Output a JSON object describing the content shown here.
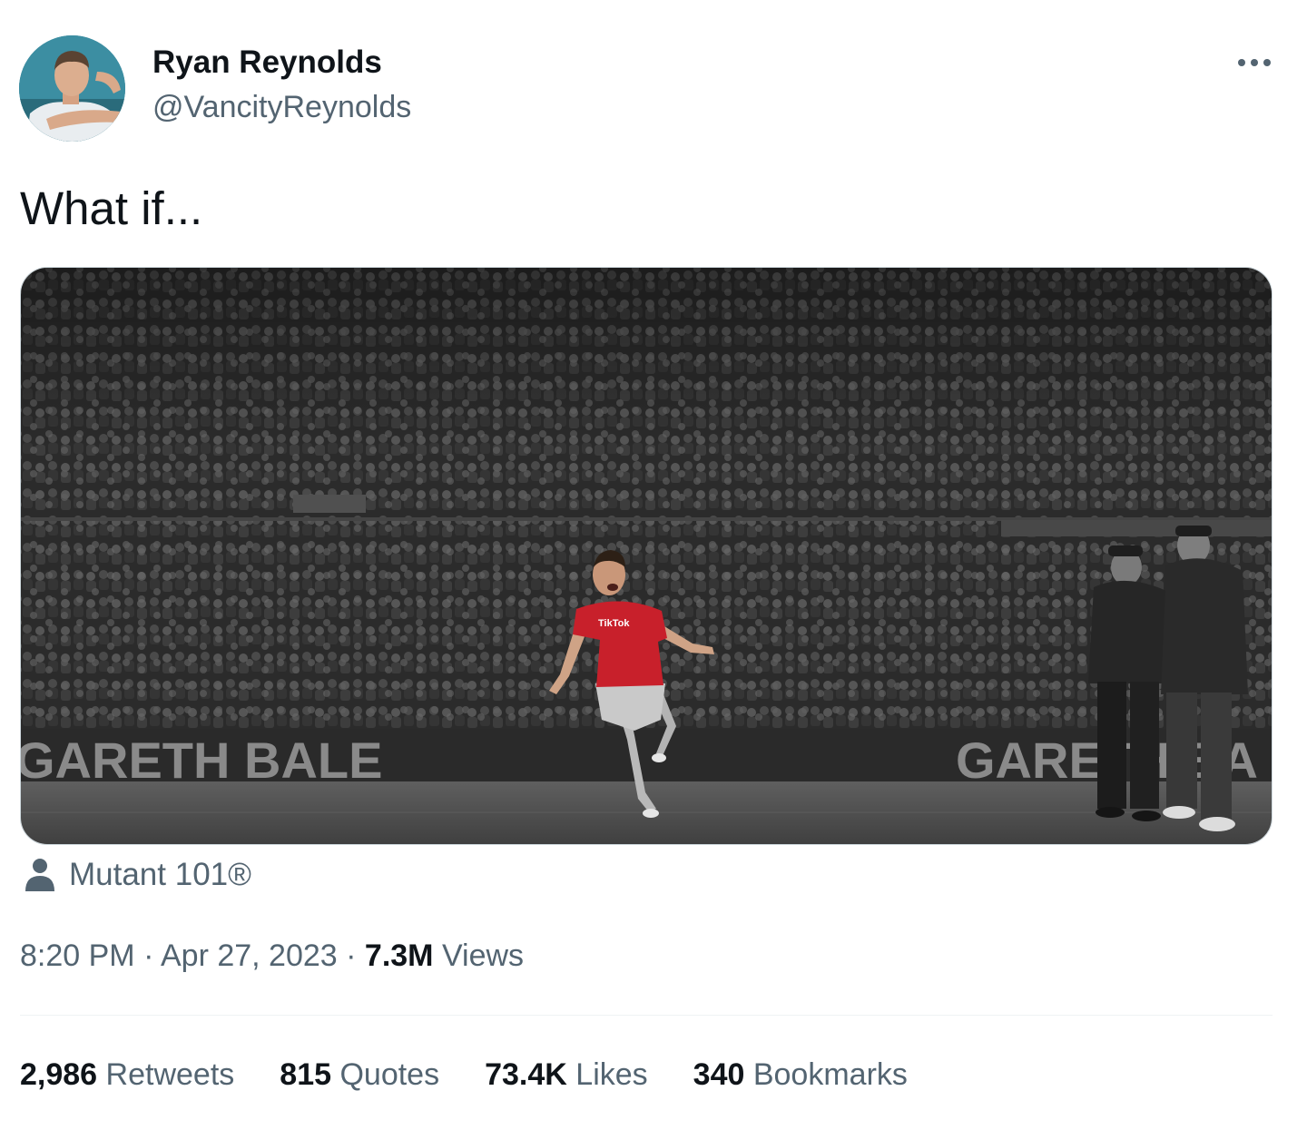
{
  "author": {
    "name": "Ryan Reynolds",
    "handle": "@VancityReynolds"
  },
  "tweet": {
    "text": "What if..."
  },
  "media": {
    "banner_left": "GARETH BALE",
    "banner_right": "GARETH BA",
    "shirt_sponsor": "TikTok",
    "tag_label": "Mutant 101®"
  },
  "meta": {
    "time": "8:20 PM",
    "date": "Apr 27, 2023",
    "views_count": "7.3M",
    "views_label": "Views"
  },
  "stats": [
    {
      "count": "2,986",
      "label": "Retweets"
    },
    {
      "count": "815",
      "label": "Quotes"
    },
    {
      "count": "73.4K",
      "label": "Likes"
    },
    {
      "count": "340",
      "label": "Bookmarks"
    }
  ],
  "icons": {
    "more": "more-horizontal-icon",
    "tag": "person-icon"
  },
  "colors": {
    "primary_text": "#0f1419",
    "secondary_text": "#536471",
    "divider": "#eff3f4",
    "jersey_red": "#c8202b"
  }
}
